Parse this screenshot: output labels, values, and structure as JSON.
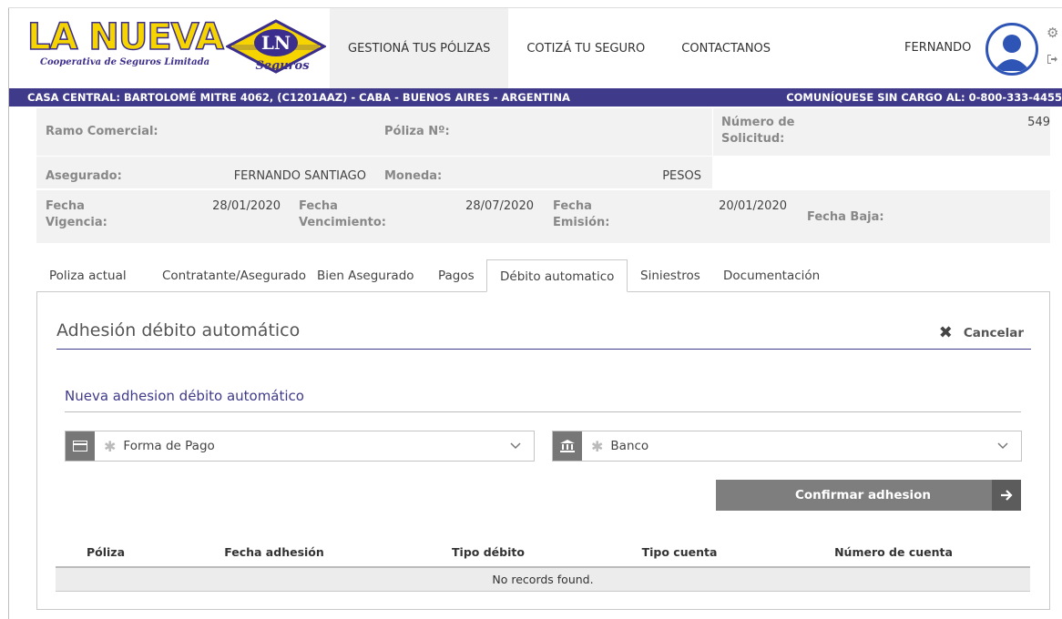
{
  "brand": {
    "name": "LA NUEVA",
    "tagline": "Cooperativa de Seguros Limitada",
    "mark_initials": "LN",
    "mark_word": "Seguros",
    "color_primary": "#3f3a8a",
    "color_logo": "#f5d400"
  },
  "nav": {
    "items": [
      {
        "label": "GESTIONÁ TUS PÓLIZAS"
      },
      {
        "label": "COTIZÁ TU SEGURO"
      },
      {
        "label": "CONTACTANOS"
      }
    ],
    "user": "FERNANDO",
    "icons": {
      "avatar": "user-avatar-icon",
      "settings": "gear-icon",
      "logout": "logout-icon"
    }
  },
  "infobar": {
    "address": "CASA CENTRAL: BARTOLOMÉ MITRE 4062, (C1201AAZ) - CABA - BUENOS AIRES - ARGENTINA",
    "phone": "COMUNÍQUESE SIN CARGO AL: 0-800-333-4455"
  },
  "policy": {
    "ramo_label": "Ramo Comercial:",
    "ramo_value": "",
    "poliza_label": "Póliza Nº:",
    "poliza_value": "",
    "solicitud_label_1": "Número de",
    "solicitud_label_2": "Solicitud:",
    "solicitud_value": "549",
    "asegurado_label": "Asegurado:",
    "asegurado_value": "FERNANDO SANTIAGO",
    "moneda_label": "Moneda:",
    "moneda_value": "PESOS",
    "vigencia_label_1": "Fecha",
    "vigencia_label_2": "Vigencia:",
    "vigencia_value": "28/01/2020",
    "vencimiento_label_1": "Fecha",
    "vencimiento_label_2": "Vencimiento:",
    "vencimiento_value": "28/07/2020",
    "emision_label_1": "Fecha",
    "emision_label_2": "Emisión:",
    "emision_value": "20/01/2020",
    "baja_label": "Fecha Baja:",
    "baja_value": ""
  },
  "tabs": [
    {
      "label": "Poliza actual"
    },
    {
      "label": "Contratante/Asegurado"
    },
    {
      "label": "Bien Asegurado"
    },
    {
      "label": "Pagos"
    },
    {
      "label": "Débito automatico",
      "active": true
    },
    {
      "label": "Siniestros"
    },
    {
      "label": "Documentación"
    }
  ],
  "panel": {
    "title": "Adhesión débito automático",
    "cancel_label": "Cancelar",
    "subtitle": "Nueva adhesion débito automático",
    "forma_pago_placeholder": "Forma de Pago",
    "banco_placeholder": "Banco",
    "confirm_label": "Confirmar adhesion"
  },
  "table": {
    "columns": [
      "Póliza",
      "Fecha adhesión",
      "Tipo débito",
      "Tipo cuenta",
      "Número de cuenta"
    ],
    "empty_message": "No records found."
  }
}
